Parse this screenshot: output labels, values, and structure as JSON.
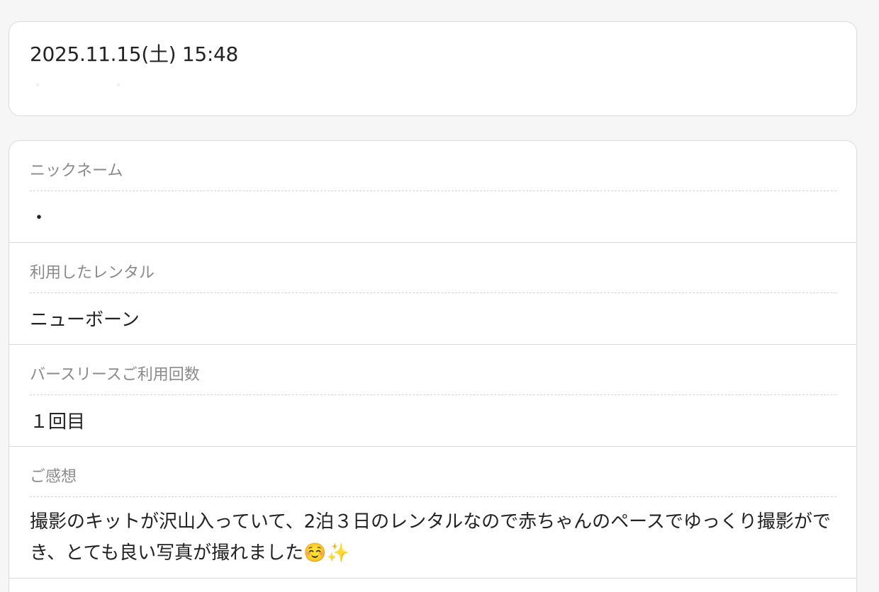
{
  "header": {
    "datetime": "2025.11.15(土) 15:48",
    "faint_left": "・",
    "faint_right": "・"
  },
  "fields": [
    {
      "label": "ニックネーム",
      "value": "・"
    },
    {
      "label": "利用したレンタル",
      "value": "ニューボーン"
    },
    {
      "label": "バースリースご利用回数",
      "value": "１回目"
    },
    {
      "label": "ご感想",
      "value": "撮影のキットが沢山入っていて、2泊３日のレンタルなので赤ちゃんのペースでゆっくり撮影ができ、とても良い写真が撮れました☺️✨"
    }
  ]
}
